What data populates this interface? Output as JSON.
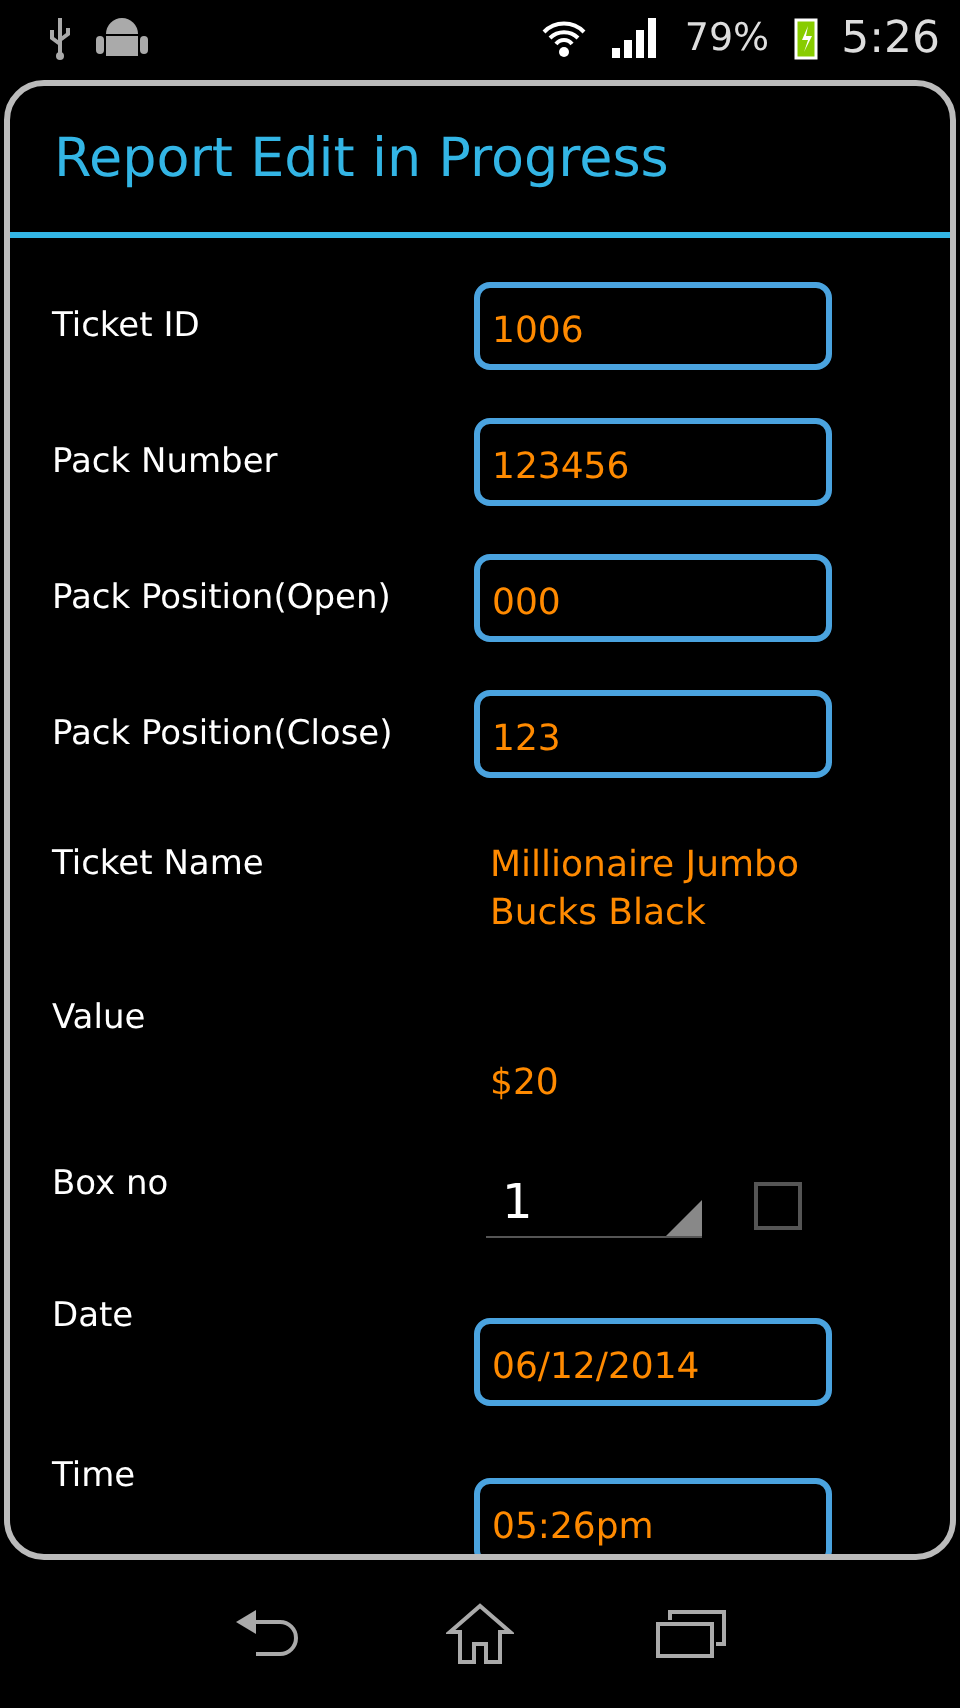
{
  "status_bar": {
    "battery": "79%",
    "time": "5:26"
  },
  "dialog": {
    "title": "Report Edit in Progress"
  },
  "rows": [
    {
      "kind": "field",
      "label": "Ticket ID",
      "value": "1006"
    },
    {
      "kind": "field",
      "label": "Pack Number",
      "value": "123456"
    },
    {
      "kind": "field",
      "label": "Pack Position(Open)",
      "value": "000"
    },
    {
      "kind": "field",
      "label": "Pack Position(Close)",
      "value": "123"
    },
    {
      "kind": "text",
      "label": "Ticket Name",
      "value": "Millionaire Jumbo Bucks Black"
    },
    {
      "kind": "value",
      "label": "Value",
      "value": "$20"
    },
    {
      "kind": "spinner",
      "label": "Box no",
      "value": "1",
      "checked": false
    },
    {
      "kind": "lowfield",
      "label": "Date",
      "value": "06/12/2014"
    },
    {
      "kind": "lowfield",
      "label": "Time",
      "value": "05:26pm"
    }
  ]
}
